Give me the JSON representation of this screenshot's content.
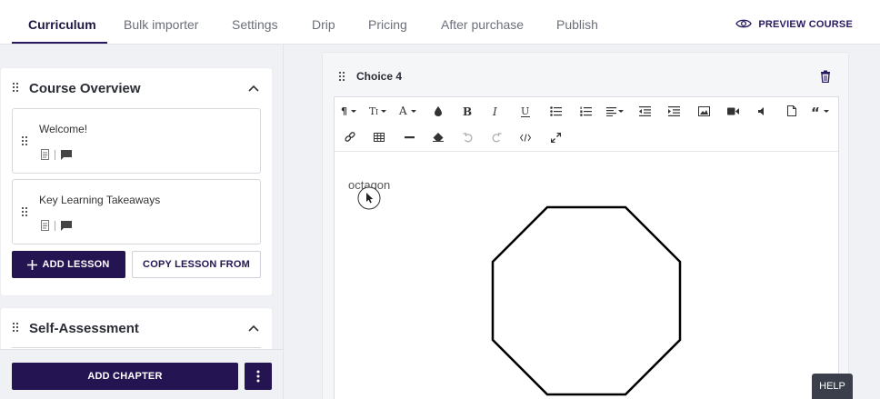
{
  "nav": {
    "tabs": [
      {
        "label": "Curriculum",
        "active": true
      },
      {
        "label": "Bulk importer"
      },
      {
        "label": "Settings"
      },
      {
        "label": "Drip"
      },
      {
        "label": "Pricing"
      },
      {
        "label": "After purchase"
      },
      {
        "label": "Publish"
      }
    ],
    "preview_label": "PREVIEW COURSE"
  },
  "sidebar": {
    "chapters": [
      {
        "title": "Course Overview",
        "lessons": [
          {
            "title": "Welcome!"
          },
          {
            "title": "Key Learning Takeaways"
          }
        ]
      },
      {
        "title": "Self-Assessment"
      }
    ],
    "add_lesson_label": "ADD LESSON",
    "copy_lesson_label": "COPY LESSON FROM",
    "add_chapter_label": "ADD CHAPTER"
  },
  "editor": {
    "choice_title": "Choice 4",
    "content_text": "octagon",
    "toolbar_icons": [
      "paragraph-format-icon",
      "font-size-icon",
      "text-color-icon",
      "background-color-icon",
      "bold-icon",
      "italic-icon",
      "underline-icon",
      "unordered-list-icon",
      "ordered-list-icon",
      "align-icon",
      "outdent-icon",
      "indent-icon",
      "insert-image-icon",
      "insert-video-icon",
      "insert-audio-icon",
      "insert-file-icon",
      "quote-icon",
      "insert-link-icon",
      "insert-table-icon",
      "horizontal-line-icon",
      "clear-formatting-icon",
      "undo-icon",
      "redo-icon",
      "code-view-icon",
      "fullscreen-icon"
    ]
  },
  "help_label": "HELP",
  "colors": {
    "brand": "#241552",
    "accent_text": "#2a1960"
  }
}
